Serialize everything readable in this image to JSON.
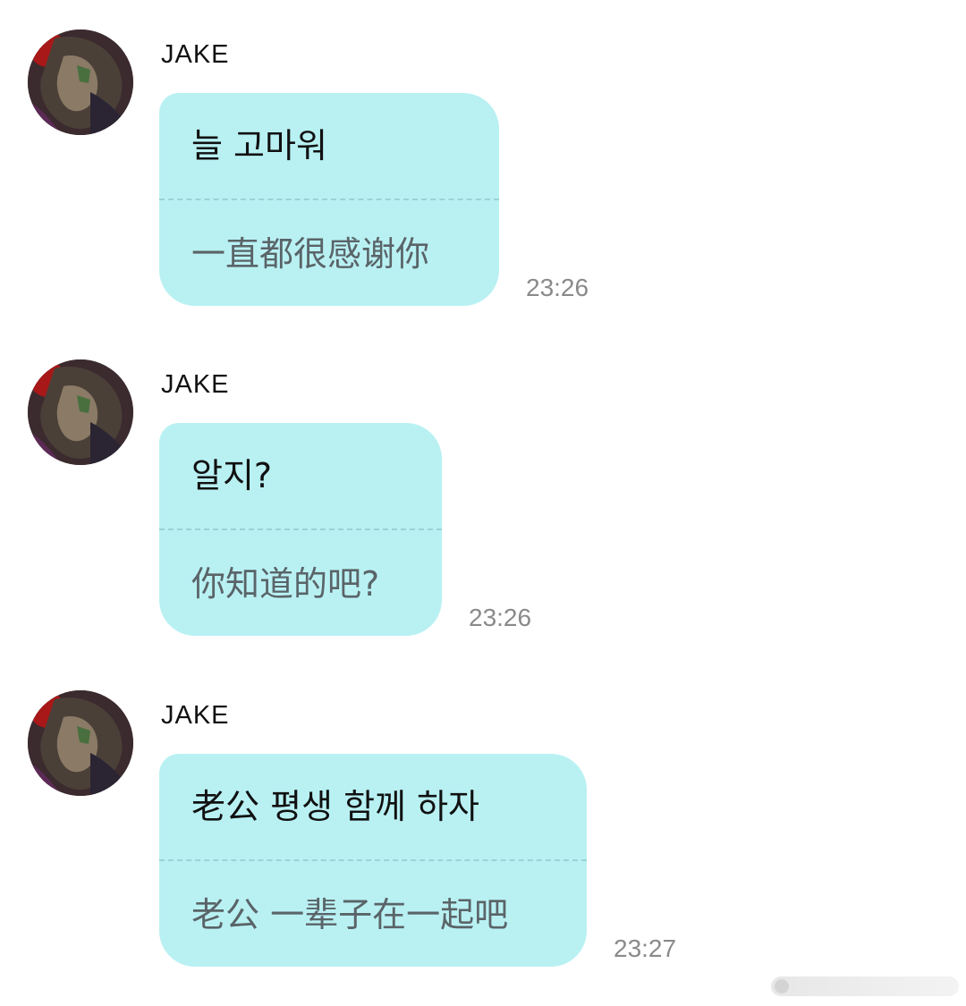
{
  "messages": [
    {
      "sender": "JAKE",
      "line1": "늘 고마워",
      "line2": "一直都很感谢你",
      "time": "23:26"
    },
    {
      "sender": "JAKE",
      "line1": "알지?",
      "line2": "你知道的吧?",
      "time": "23:26"
    },
    {
      "sender": "JAKE",
      "line1": "老公 평생 함께 하자",
      "line2": "老公 一辈子在一起吧",
      "time": "23:27"
    }
  ],
  "colors": {
    "bubble": "#b9f1f3",
    "divider": "#98d3d6",
    "time": "#8a8a8a"
  }
}
